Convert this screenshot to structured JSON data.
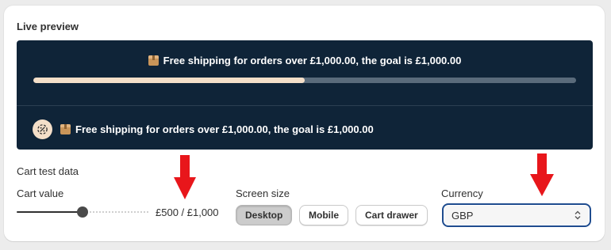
{
  "preview": {
    "title": "Live preview",
    "bar_message": "Free shipping for orders over £1,000.00, the goal is £1,000.00",
    "progress_fraction": 0.5,
    "second_message": "Free shipping for orders over £1,000.00, the goal is £1,000.00",
    "colors": {
      "background": "#0f2438",
      "progress_fill": "#f4dfc9",
      "progress_track": "#5a6b7b"
    }
  },
  "cart_test": {
    "title": "Cart test data",
    "cart_value_label": "Cart value",
    "cart_value_text": "£500 / £1,000",
    "screen_size_label": "Screen size",
    "screen_sizes": [
      "Desktop",
      "Mobile",
      "Cart drawer"
    ],
    "selected_screen_size": "Desktop",
    "currency_label": "Currency",
    "currency_value": "GBP"
  },
  "icons": [
    "package-icon",
    "free-shipping-badge-icon",
    "chevron-updown-icon"
  ],
  "annotations": {
    "arrow_color": "#e8161b"
  }
}
